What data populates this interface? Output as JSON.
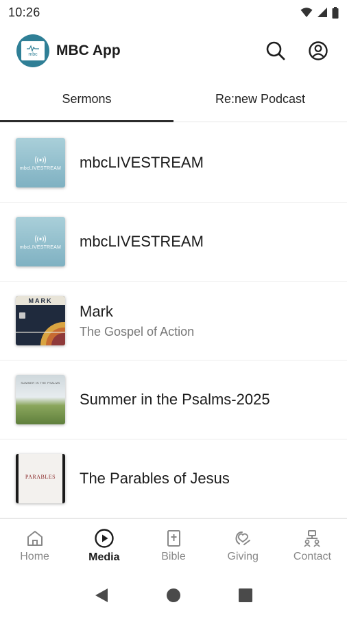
{
  "status_bar": {
    "time": "10:26",
    "icons": [
      "wifi-icon",
      "signal-icon",
      "battery-icon"
    ]
  },
  "app_bar": {
    "title": "MBC App",
    "logo_text": "mbc",
    "actions": [
      "search-icon",
      "account-icon"
    ]
  },
  "tabs": [
    {
      "label": "Sermons",
      "active": true
    },
    {
      "label": "Re:new Podcast",
      "active": false
    }
  ],
  "list": {
    "items": [
      {
        "title": "mbcLIVESTREAM",
        "subtitle": "",
        "thumb": "livestream",
        "thumb_label": "mbcLIVESTREAM"
      },
      {
        "title": "mbcLIVESTREAM",
        "subtitle": "",
        "thumb": "livestream",
        "thumb_label": "mbcLIVESTREAM"
      },
      {
        "title": "Mark",
        "subtitle": "The Gospel of Action",
        "thumb": "mark",
        "thumb_label": "MARK"
      },
      {
        "title": "Summer in the Psalms-2025",
        "subtitle": "",
        "thumb": "summer",
        "thumb_label": "SUMMER IN THE PSALMS"
      },
      {
        "title": "The Parables of Jesus",
        "subtitle": "",
        "thumb": "parables",
        "thumb_label": "PARABLES"
      }
    ]
  },
  "bottom_nav": {
    "items": [
      {
        "label": "Home",
        "icon": "home-icon",
        "active": false
      },
      {
        "label": "Media",
        "icon": "play-circle-icon",
        "active": true
      },
      {
        "label": "Bible",
        "icon": "bible-icon",
        "active": false
      },
      {
        "label": "Giving",
        "icon": "giving-icon",
        "active": false
      },
      {
        "label": "Contact",
        "icon": "contact-icon",
        "active": false
      }
    ]
  },
  "system_nav": [
    "back-icon",
    "home-circle-icon",
    "recents-icon"
  ],
  "colors": {
    "accent": "#2f7f96",
    "text_primary": "#1c1c1c",
    "text_secondary": "#777777",
    "nav_inactive": "#888888"
  }
}
